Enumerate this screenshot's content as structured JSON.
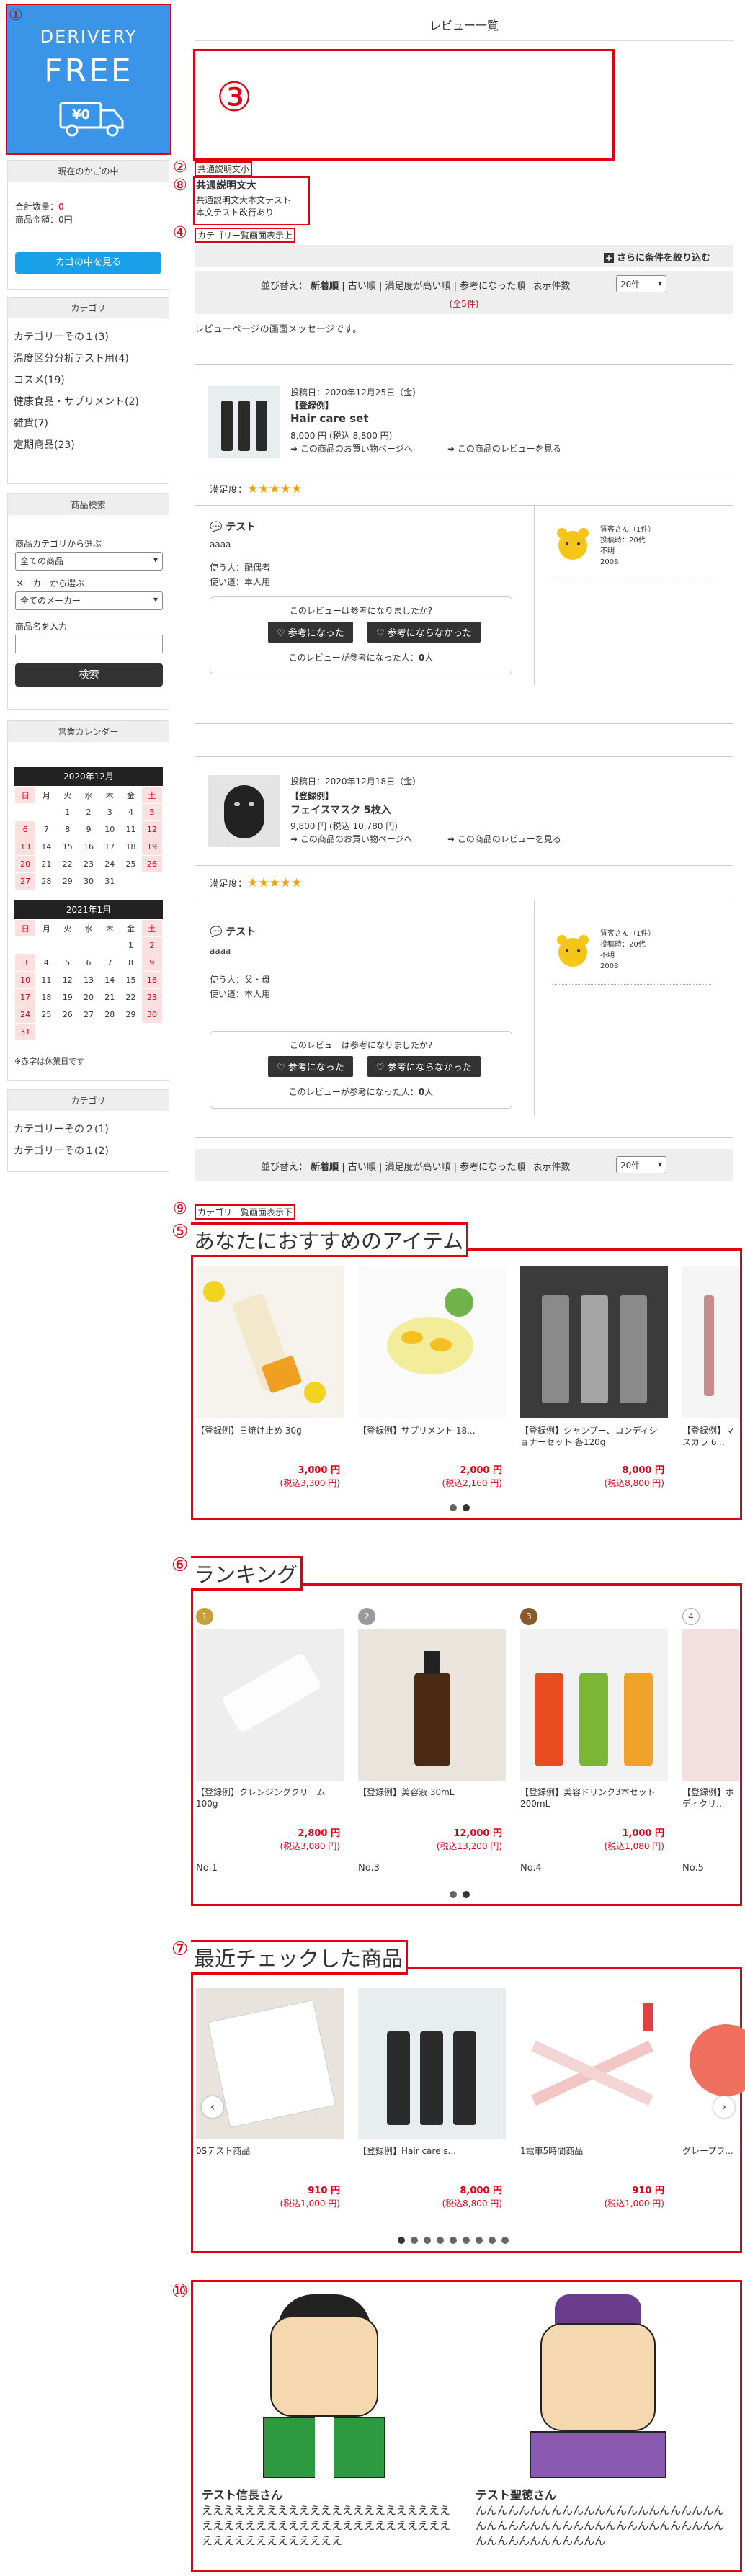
{
  "brand": {
    "line1": "DERIVERY",
    "line2": "FREE",
    "price_tag": "¥0"
  },
  "markers": {
    "m1": "①",
    "m2": "②",
    "m3": "③",
    "m4": "④",
    "m5": "⑤",
    "m6": "⑥",
    "m7": "⑦",
    "m8": "⑧",
    "m9": "⑨",
    "m10": "⑩"
  },
  "page_title": "レビュー一覧",
  "cart": {
    "heading": "現在のかごの中",
    "count_label": "合計数量：",
    "count": "0",
    "total_label": "商品金額：0円",
    "button": "カゴの中を見る"
  },
  "categories": {
    "heading": "カテゴリ",
    "items": [
      "カテゴリーその１(3)",
      "温度区分分析テスト用(4)",
      "コスメ(19)",
      "健康食品・サプリメント(2)",
      "雑貨(7)",
      "定期商品(23)"
    ]
  },
  "search": {
    "heading": "商品検索",
    "cat_label": "商品カテゴリから選ぶ",
    "cat_value": "全ての商品",
    "maker_label": "メーカーから選ぶ",
    "maker_value": "全てのメーカー",
    "name_label": "商品名を入力",
    "button": "検索"
  },
  "calendar": {
    "heading": "営業カレンダー",
    "weekdays": [
      "日",
      "月",
      "火",
      "水",
      "木",
      "金",
      "土"
    ],
    "months": [
      {
        "title": "2020年12月",
        "rows": [
          [
            "",
            "",
            "1",
            "2",
            "3",
            "4",
            "5"
          ],
          [
            "6",
            "7",
            "8",
            "9",
            "10",
            "11",
            "12"
          ],
          [
            "13",
            "14",
            "15",
            "16",
            "17",
            "18",
            "19"
          ],
          [
            "20",
            "21",
            "22",
            "23",
            "24",
            "25",
            "26"
          ],
          [
            "27",
            "28",
            "29",
            "30",
            "31",
            "",
            ""
          ]
        ]
      },
      {
        "title": "2021年1月",
        "rows": [
          [
            "",
            "",
            "",
            "",
            "",
            "1",
            "2"
          ],
          [
            "3",
            "4",
            "5",
            "6",
            "7",
            "8",
            "9"
          ],
          [
            "10",
            "11",
            "12",
            "13",
            "14",
            "15",
            "16"
          ],
          [
            "17",
            "18",
            "19",
            "20",
            "21",
            "22",
            "23"
          ],
          [
            "24",
            "25",
            "26",
            "27",
            "28",
            "29",
            "30"
          ],
          [
            "31",
            "",
            "",
            "",
            "",
            "",
            ""
          ]
        ]
      }
    ],
    "note": "※赤字は休業日です"
  },
  "categories2": {
    "heading": "カテゴリ",
    "items": [
      "カテゴリーその２(1)",
      "カテゴリーその１(2)"
    ]
  },
  "notes": {
    "small": "共通説明文小",
    "large": "共通説明文大",
    "large_body1": "共通説明文大本文テスト",
    "large_body2": "本文テスト改行あり",
    "cat_top": "カテゴリー覧画面表示上",
    "cat_bottom": "カテゴリー覧画面表示下"
  },
  "filter_button": "さらに条件を絞り込む",
  "sort": {
    "label": "並び替え：",
    "options": [
      "新着順",
      "古い順",
      "満足度が高い順",
      "参考になった順"
    ],
    "count_label": "表示件数",
    "count_value": "20件",
    "total": "(全5件)"
  },
  "review_message": "レビューページの画面メッセージです。",
  "reviews": [
    {
      "posted": "投稿日：2020年12月25日（金）",
      "tag": "【登録例】",
      "name": "Hair care set",
      "price": "8,000 円 (税込 8,800 円)",
      "link_buy": "この商品のお買い物ページへ",
      "link_reviews": "この商品のレビューを見る",
      "sat_label": "満足度：",
      "stars": "★★★★★",
      "title": "テスト",
      "body": "aaaa",
      "user": "使う人：配偶者",
      "usage": "使い道：本人用",
      "q": "このレビューは参考になりましたか?",
      "yes": "参考になった",
      "no": "参考にならなかった",
      "helpful_pre": "このレビューが参考になった人：",
      "helpful_n": "0",
      "helpful_post": "人",
      "rev_name": "質客さん（1件）",
      "rev_age": "投稿時：20代",
      "rev_sex": "不明",
      "rev_area": "2008"
    },
    {
      "posted": "投稿日：2020年12月18日（金）",
      "tag": "【登録例】",
      "name": "フェイスマスク 5枚入",
      "price": "9,800 円 (税込 10,780 円)",
      "link_buy": "この商品のお買い物ページへ",
      "link_reviews": "この商品のレビューを見る",
      "sat_label": "満足度：",
      "stars": "★★★★★",
      "title": "テスト",
      "body": "aaaa",
      "user": "使う人：父・母",
      "usage": "使い道：本人用",
      "q": "このレビューは参考になりましたか?",
      "yes": "参考になった",
      "no": "参考にならなかった",
      "helpful_pre": "このレビューが参考になった人：",
      "helpful_n": "0",
      "helpful_post": "人",
      "rev_name": "質客さん（1件）",
      "rev_age": "投稿時：20代",
      "rev_sex": "不明",
      "rev_area": "2008"
    }
  ],
  "recommend": {
    "title": "あなたにおすすめのアイテム",
    "items": [
      {
        "name": "【登録例】日焼け止め 30g",
        "price": "3,000 円",
        "tax": "(税込3,300 円)"
      },
      {
        "name": "【登録例】サプリメント 18...",
        "price": "2,000 円",
        "tax": "(税込2,160 円)"
      },
      {
        "name": "【登録例】シャンプー、コンディショナーセット 各120g",
        "price": "8,000 円",
        "tax": "(税込8,800 円)"
      },
      {
        "name": "【登録例】マスカラ 6...",
        "price": "",
        "tax": ""
      }
    ]
  },
  "ranking": {
    "title": "ランキング",
    "items": [
      {
        "rank": "1",
        "name": "【登録例】クレンジングクリーム 100g",
        "price": "2,800 円",
        "tax": "(税込3,080 円)",
        "no": "No.1"
      },
      {
        "rank": "2",
        "name": "【登録例】美容液 30mL",
        "price": "12,000 円",
        "tax": "(税込13,200 円)",
        "no": "No.3"
      },
      {
        "rank": "3",
        "name": "【登録例】美容ドリンク3本セット 200mL",
        "price": "1,000 円",
        "tax": "(税込1,080 円)",
        "no": "No.4"
      },
      {
        "rank": "4",
        "name": "【登録例】ボディクリ...",
        "price": "",
        "tax": "",
        "no": "No.5"
      }
    ]
  },
  "recent": {
    "title": "最近チェックした商品",
    "items": [
      {
        "name": "0Sテスト商品",
        "price": "910 円",
        "tax": "(税込1,000 円)"
      },
      {
        "name": "【登録例】Hair care s...",
        "price": "8,000 円",
        "tax": "(税込8,800 円)"
      },
      {
        "name": "1電車5時間商品",
        "price": "910 円",
        "tax": "(税込1,000 円)"
      },
      {
        "name": "グレープフ...",
        "price": "",
        "tax": ""
      }
    ]
  },
  "banners": [
    {
      "name": "テスト信長さん",
      "text": "えええええええええええええええええええええええええええええええええええええええええええええええええええええええええええ"
    },
    {
      "name": "テスト聖徳さん",
      "text": "んんんんんんんんんんんんんんんんんんんんんんんんんんんんんんんんんんんんんんんんんんんんんんんんんんんんんんんんんん"
    }
  ]
}
